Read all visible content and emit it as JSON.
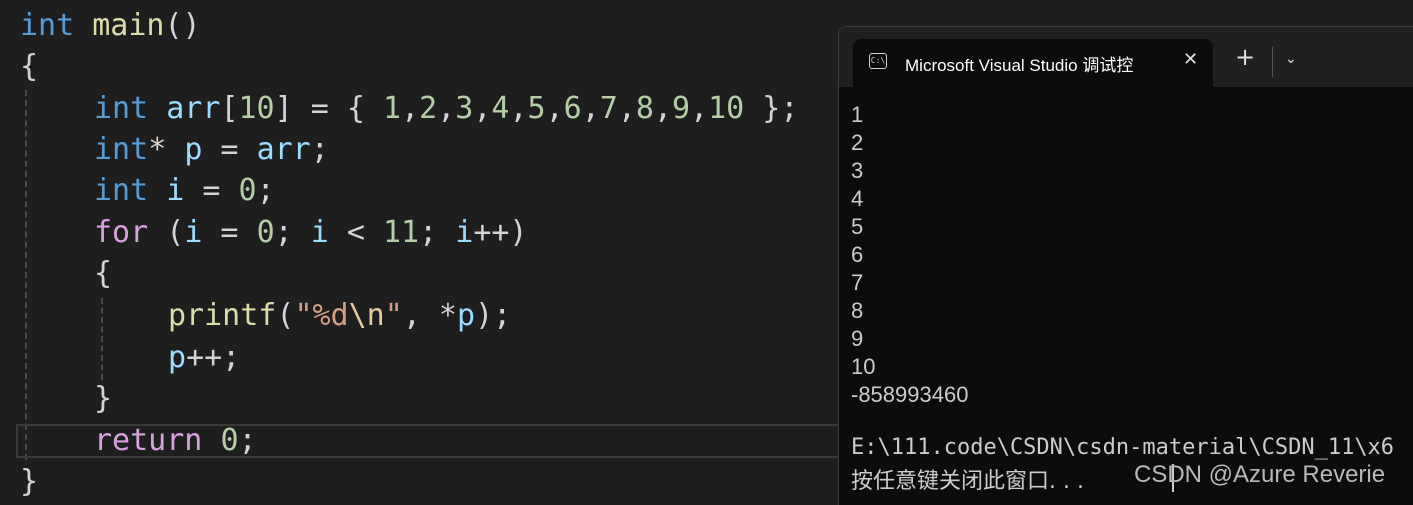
{
  "editor": {
    "line1": {
      "kw": "int",
      "fn": "main",
      "punc": "()"
    },
    "line2": {
      "brace": "{"
    },
    "line3": {
      "kw": "int",
      "id": "arr",
      "rest_a": "[",
      "num10": "10",
      "rest_b": "] = { ",
      "n1": "1",
      "n2": "2",
      "n3": "3",
      "n4": "4",
      "n5": "5",
      "n6": "6",
      "n7": "7",
      "n8": "8",
      "n9": "9",
      "n10": "10",
      "comma": ",",
      "end": " };"
    },
    "line4": {
      "kw": "int",
      "star": "*",
      "id_p": "p",
      "eq": " = ",
      "id_arr": "arr",
      "semi": ";"
    },
    "line5": {
      "kw": "int",
      "id_i": "i",
      "eq": " = ",
      "num": "0",
      "semi": ";"
    },
    "line6": {
      "kw": "for",
      "open": " (",
      "i1": "i",
      "eq": " = ",
      "n0": "0",
      "s1": "; ",
      "i2": "i",
      "lt": " < ",
      "n11": "11",
      "s2": "; ",
      "i3": "i",
      "inc": "++)"
    },
    "line7": {
      "brace": "{"
    },
    "line8": {
      "fn": "printf",
      "open": "(",
      "q1": "\"",
      "fmt": "%d",
      "esc": "\\n",
      "q2": "\"",
      "mid": ", *",
      "id_p": "p",
      "end": ");"
    },
    "line9": {
      "id_p": "p",
      "rest": "++;"
    },
    "line10": {
      "brace": "}"
    },
    "line11": {
      "kw": "return",
      "num": "0",
      "semi": ";"
    },
    "line12": {
      "brace": "}"
    }
  },
  "console": {
    "tab_title": "Microsoft Visual Studio 调试控",
    "tab_icon": "C:\\",
    "close_label": "✕",
    "new_tab_label": "+",
    "dropdown_label": "⌄",
    "output": [
      "1",
      "2",
      "3",
      "4",
      "5",
      "6",
      "7",
      "8",
      "9",
      "10",
      "-858993460"
    ],
    "path_line": "E:\\111.code\\CSDN\\csdn-material\\CSDN_11\\x6",
    "prompt_line": "按任意键关闭此窗口. . .",
    "watermark": "CSDN @Azure Reverie"
  },
  "colors": {
    "keyword": "#569cd6",
    "control_keyword": "#d8a0df",
    "identifier": "#9cdcfe",
    "function": "#dcdcaa",
    "number": "#b5cea8",
    "string": "#d69d85"
  }
}
